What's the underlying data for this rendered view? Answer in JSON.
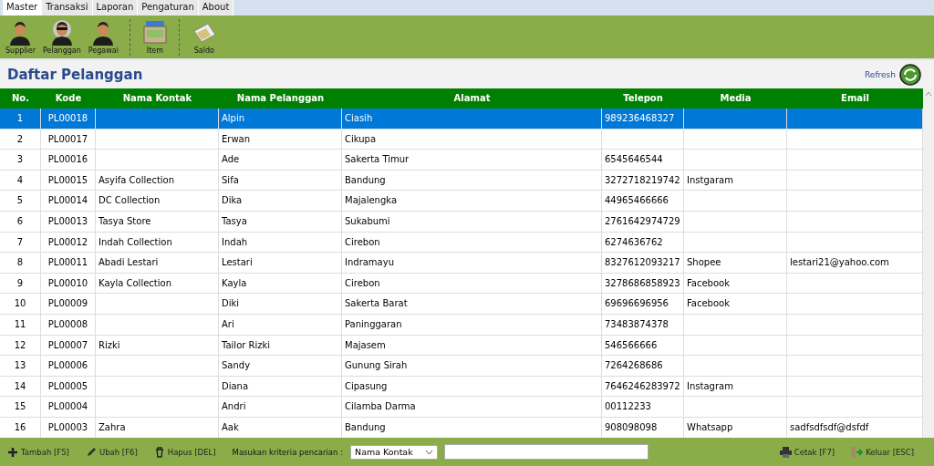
{
  "tabs": [
    {
      "label": "Master",
      "selected": true
    },
    {
      "label": "Transaksi",
      "selected": false
    },
    {
      "label": "Laporan",
      "selected": false
    },
    {
      "label": "Pengaturan",
      "selected": false
    },
    {
      "label": "About",
      "selected": false
    }
  ],
  "toolbar": [
    [
      {
        "label": "Supplier",
        "kind": "person"
      },
      {
        "label": "Pelanggan",
        "kind": "sunglasses"
      },
      {
        "label": "Pegawai",
        "kind": "person"
      }
    ],
    [
      {
        "label": "Item",
        "kind": "register"
      }
    ],
    [
      {
        "label": "Saldo",
        "kind": "money"
      }
    ]
  ],
  "page_title": "Daftar Pelanggan",
  "refresh": "Refresh",
  "table": {
    "columns": [
      "No.",
      "Kode",
      "Nama Kontak",
      "Nama Pelanggan",
      "Alamat",
      "Telepon",
      "Media",
      "Email"
    ],
    "rows": [
      {
        "selected": true,
        "cells": [
          "1",
          "PL00018",
          "",
          "Alpin",
          "Ciasih",
          "989236468327",
          "",
          ""
        ]
      },
      {
        "selected": false,
        "cells": [
          "2",
          "PL00017",
          "",
          "Erwan",
          "Cikupa",
          "",
          "",
          ""
        ]
      },
      {
        "selected": false,
        "cells": [
          "3",
          "PL00016",
          "",
          "Ade",
          "Sakerta Timur",
          "6545646544",
          "",
          ""
        ]
      },
      {
        "selected": false,
        "cells": [
          "4",
          "PL00015",
          "Asyifa Collection",
          "Sifa",
          "Bandung",
          "3272718219742",
          "Instgaram",
          ""
        ]
      },
      {
        "selected": false,
        "cells": [
          "5",
          "PL00014",
          "DC Collection",
          "Dika",
          "Majalengka",
          "44965466666",
          "",
          ""
        ]
      },
      {
        "selected": false,
        "cells": [
          "6",
          "PL00013",
          "Tasya Store",
          "Tasya",
          "Sukabumi",
          "2761642974729",
          "",
          ""
        ]
      },
      {
        "selected": false,
        "cells": [
          "7",
          "PL00012",
          "Indah Collection",
          "Indah",
          "Cirebon",
          "6274636762",
          "",
          ""
        ]
      },
      {
        "selected": false,
        "cells": [
          "8",
          "PL00011",
          "Abadi Lestari",
          "Lestari",
          "Indramayu",
          "8327612093217",
          "Shopee",
          "lestari21@yahoo.com"
        ]
      },
      {
        "selected": false,
        "cells": [
          "9",
          "PL00010",
          "Kayla Collection",
          "Kayla",
          "Cirebon",
          "3278686858923",
          "Facebook",
          ""
        ]
      },
      {
        "selected": false,
        "cells": [
          "10",
          "PL00009",
          "",
          "Diki",
          "Sakerta Barat",
          "69696696956",
          "Facebook",
          ""
        ]
      },
      {
        "selected": false,
        "cells": [
          "11",
          "PL00008",
          "",
          "Ari",
          "Paninggaran",
          "73483874378",
          "",
          ""
        ]
      },
      {
        "selected": false,
        "cells": [
          "12",
          "PL00007",
          "Rizki",
          "Tailor Rizki",
          "Majasem",
          "546566666",
          "",
          ""
        ]
      },
      {
        "selected": false,
        "cells": [
          "13",
          "PL00006",
          "",
          "Sandy",
          "Gunung Sirah",
          "7264268686",
          "",
          ""
        ]
      },
      {
        "selected": false,
        "cells": [
          "14",
          "PL00005",
          "",
          "Diana",
          "Cipasung",
          "7646246283972",
          "Instagram",
          ""
        ]
      },
      {
        "selected": false,
        "cells": [
          "15",
          "PL00004",
          "",
          "Andri",
          "Cilamba Darma",
          "00112233",
          "",
          ""
        ]
      },
      {
        "selected": false,
        "cells": [
          "16",
          "PL00003",
          "Zahra",
          "Aak",
          "Bandung",
          "908098098",
          "Whatsapp",
          "sadfsdfsdf@dsfdf"
        ]
      }
    ]
  },
  "footer": {
    "left": [
      {
        "label": "Tambah [F5]",
        "kind": "plus"
      },
      {
        "label": "Ubah [F6]",
        "kind": "pencil"
      },
      {
        "label": "Hapus [DEL]",
        "kind": "trash"
      }
    ],
    "search_label": "Masukan kriteria pencarian :",
    "search_select": "Nama Kontak",
    "right": [
      {
        "label": "Cetak [F7]",
        "kind": "printer"
      },
      {
        "label": "Keluar [ESC]",
        "kind": "exit"
      }
    ]
  }
}
